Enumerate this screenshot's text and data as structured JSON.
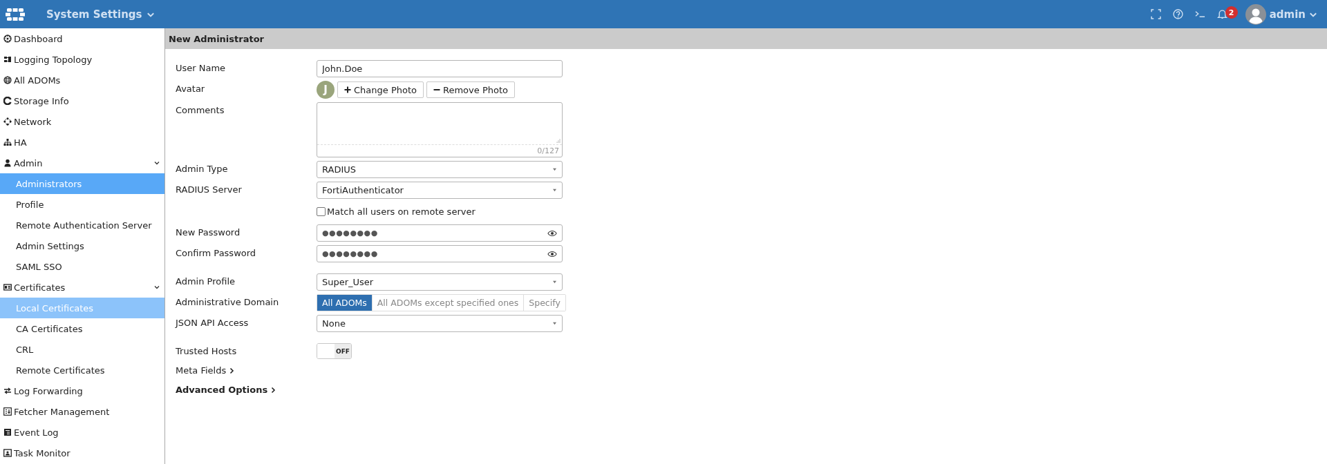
{
  "topbar": {
    "title": "System Settings",
    "notification_count": "2",
    "user": "admin"
  },
  "sidebar": {
    "items": [
      {
        "label": "Dashboard",
        "selected": false,
        "hovered": false
      },
      {
        "label": "Logging Topology",
        "selected": false,
        "hovered": false
      },
      {
        "label": "All ADOMs",
        "selected": false,
        "hovered": false
      },
      {
        "label": "Storage Info",
        "selected": false,
        "hovered": false
      },
      {
        "label": "Network",
        "selected": false,
        "hovered": false
      },
      {
        "label": "HA",
        "selected": false,
        "hovered": false
      },
      {
        "label": "Admin",
        "selected": false,
        "hovered": false,
        "expanded": true,
        "children": [
          {
            "label": "Administrators",
            "selected": true,
            "hovered": false
          },
          {
            "label": "Profile",
            "selected": false,
            "hovered": false
          },
          {
            "label": "Remote Authentication Server",
            "selected": false,
            "hovered": false
          },
          {
            "label": "Admin Settings",
            "selected": false,
            "hovered": false
          },
          {
            "label": "SAML SSO",
            "selected": false,
            "hovered": false
          }
        ]
      },
      {
        "label": "Certificates",
        "selected": false,
        "hovered": false,
        "expanded": true,
        "children": [
          {
            "label": "Local Certificates",
            "selected": false,
            "hovered": true
          },
          {
            "label": "CA Certificates",
            "selected": false,
            "hovered": false
          },
          {
            "label": "CRL",
            "selected": false,
            "hovered": false
          },
          {
            "label": "Remote Certificates",
            "selected": false,
            "hovered": false
          }
        ]
      },
      {
        "label": "Log Forwarding",
        "selected": false,
        "hovered": false
      },
      {
        "label": "Fetcher Management",
        "selected": false,
        "hovered": false
      },
      {
        "label": "Event Log",
        "selected": false,
        "hovered": false
      },
      {
        "label": "Task Monitor",
        "selected": false,
        "hovered": false
      }
    ]
  },
  "page": {
    "title": "New Administrator"
  },
  "form": {
    "sections": [
      [
        {
          "kind": "text",
          "label": "User Name",
          "value": "John.Doe"
        },
        {
          "kind": "avatar",
          "label": "Avatar",
          "initial": "J",
          "buttons": [
            {
              "label": "Change Photo"
            },
            {
              "label": "Remove Photo"
            }
          ]
        },
        {
          "kind": "textarea",
          "label": "Comments",
          "counter": "0/127"
        },
        {
          "kind": "select",
          "label": "Admin Type",
          "value": "RADIUS"
        },
        {
          "kind": "select",
          "label": "RADIUS Server",
          "value": "FortiAuthenticator"
        },
        {
          "kind": "checkbox",
          "label": "Match all users on remote server",
          "checked": false
        },
        {
          "kind": "password",
          "label": "New Password",
          "value": "●●●●●●●●"
        },
        {
          "kind": "password",
          "label": "Confirm Password",
          "value": "●●●●●●●●"
        }
      ],
      [
        {
          "kind": "select",
          "label": "Admin Profile",
          "value": "Super_User"
        },
        {
          "kind": "segmented",
          "label": "Administrative Domain",
          "options": [
            {
              "label": "All ADOMs",
              "selected": true
            },
            {
              "label": "All ADOMs except specified ones",
              "selected": false
            },
            {
              "label": "Specify",
              "selected": false
            }
          ]
        },
        {
          "kind": "select",
          "label": "JSON API Access",
          "value": "None"
        }
      ],
      [
        {
          "kind": "toggle",
          "label": "Trusted Hosts",
          "on": false,
          "state_text": "OFF"
        },
        {
          "kind": "expander",
          "label": "Meta Fields",
          "bold": false,
          "expanded": false
        },
        {
          "kind": "expander",
          "label": "Advanced Options",
          "bold": true,
          "expanded": false
        }
      ]
    ]
  }
}
